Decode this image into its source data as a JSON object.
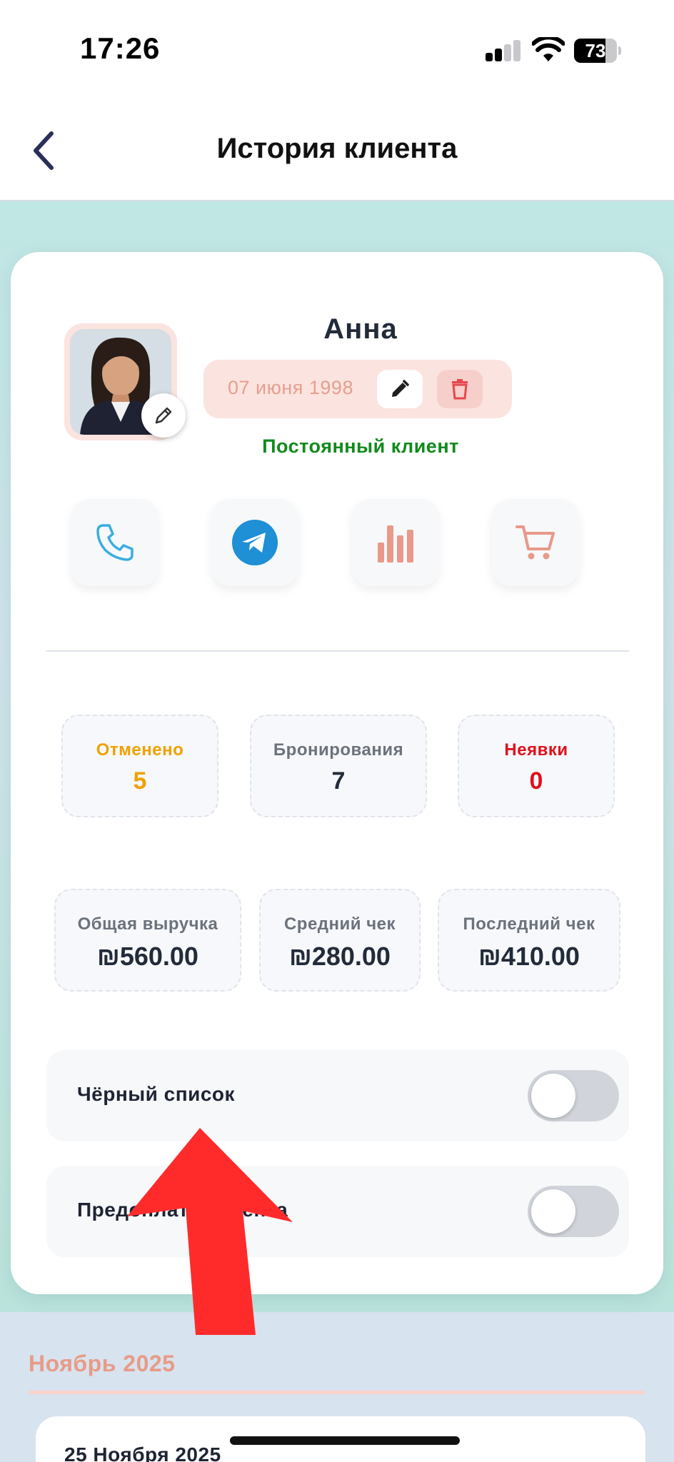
{
  "status_bar": {
    "time": "17:26",
    "battery": "73",
    "battery_level": 0.73,
    "signal_bars": 2
  },
  "header": {
    "back_icon": "chevron-left-icon",
    "title": "История клиента"
  },
  "client": {
    "name": "Анна",
    "birth_date": "07 июня 1998",
    "status": "Постоянный клиент",
    "avatar_edit_icon": "pencil-icon"
  },
  "actions": [
    {
      "icon": "phone-icon",
      "color": "#3aaee0"
    },
    {
      "icon": "telegram-icon",
      "color": "#1f8fd6"
    },
    {
      "icon": "bar-chart-icon",
      "color": "#e8998a"
    },
    {
      "icon": "cart-icon",
      "color": "#e8998a"
    }
  ],
  "stats_row1": [
    {
      "label": "Отменено",
      "value": "5",
      "color": "#f0a100"
    },
    {
      "label": "Бронирования",
      "value": "7",
      "color": "#222b3a"
    },
    {
      "label": "Неявки",
      "value": "0",
      "color": "#e0101b"
    }
  ],
  "stats_row2": [
    {
      "label": "Общая выручка",
      "value": "₪560.00"
    },
    {
      "label": "Средний чек",
      "value": "₪280.00"
    },
    {
      "label": "Последний чек",
      "value": "₪410.00"
    }
  ],
  "toggles": {
    "blacklist": {
      "label": "Чёрный список",
      "on": false
    },
    "prepayment": {
      "label": "Предоплата клиента",
      "on": false
    }
  },
  "history": {
    "month": "Ноябрь 2025",
    "first_entry_date": "25 Ноября 2025"
  },
  "annotation": {
    "icon": "red-arrow-up-icon",
    "color": "#ff2b2b"
  }
}
